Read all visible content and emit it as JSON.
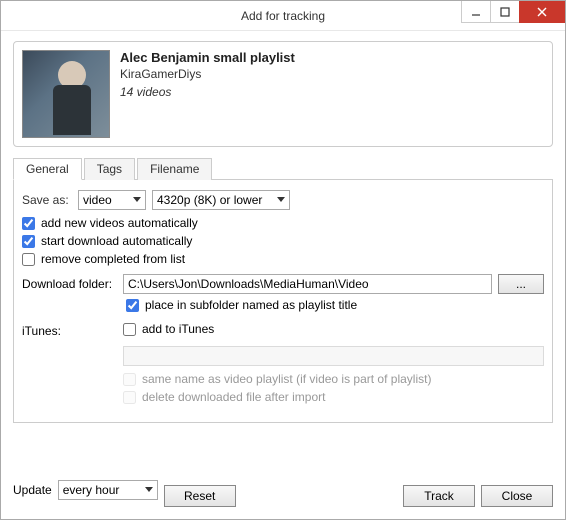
{
  "window": {
    "title": "Add for tracking"
  },
  "playlist": {
    "title": "Alec Benjamin small playlist",
    "author": "KiraGamerDiys",
    "count_text": "14 videos"
  },
  "tabs": {
    "general": "General",
    "tags": "Tags",
    "filename": "Filename"
  },
  "general": {
    "save_as_label": "Save as:",
    "save_as_type": "video",
    "save_as_quality": "4320p (8K) or lower",
    "chk_add_new": "add new videos automatically",
    "chk_start_download": "start download automatically",
    "chk_remove_completed": "remove completed from list",
    "download_folder_label": "Download folder:",
    "download_folder_value": "C:\\Users\\Jon\\Downloads\\MediaHuman\\Video",
    "browse_label": "...",
    "chk_subfolder": "place in subfolder named as playlist title",
    "itunes_label": "iTunes:",
    "chk_add_itunes": "add to iTunes",
    "chk_same_name": "same name as video playlist (if video is part of playlist)",
    "chk_delete_after": "delete downloaded file after import"
  },
  "footer": {
    "update_label": "Update",
    "update_value": "every hour",
    "reset": "Reset",
    "track": "Track",
    "close": "Close"
  }
}
